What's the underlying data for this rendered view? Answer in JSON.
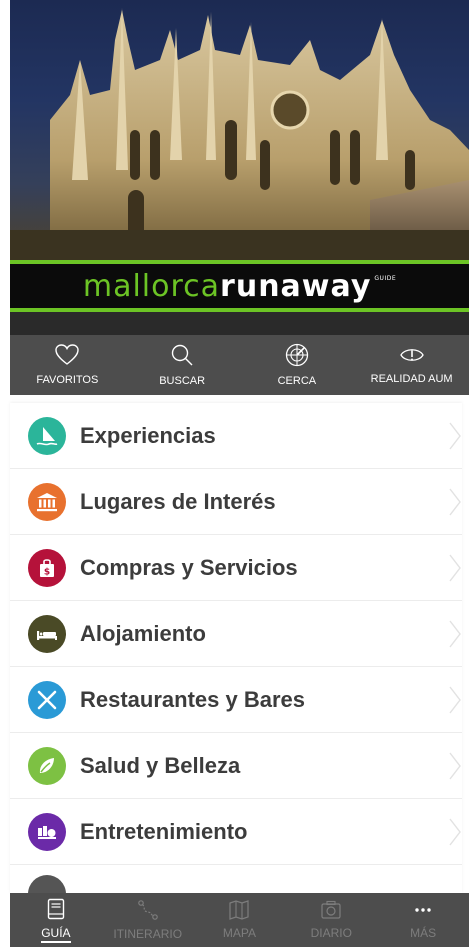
{
  "brand": {
    "part1": "mallorca",
    "part2": "runaway",
    "tag": "GUIDE"
  },
  "quick_actions": [
    {
      "label": "FAVORITOS",
      "icon": "heart-icon"
    },
    {
      "label": "BUSCAR",
      "icon": "search-icon"
    },
    {
      "label": "CERCA",
      "icon": "radar-icon"
    },
    {
      "label": "REALIDAD AUM",
      "icon": "ar-eye-icon"
    }
  ],
  "categories": [
    {
      "label": "Experiencias",
      "icon": "windsurf-icon",
      "color": "#2bb59a"
    },
    {
      "label": "Lugares de Interés",
      "icon": "museum-icon",
      "color": "#e8712e"
    },
    {
      "label": "Compras y Servicios",
      "icon": "shopping-bag-icon",
      "color": "#b5123a"
    },
    {
      "label": "Alojamiento",
      "icon": "bed-icon",
      "color": "#4a4a26"
    },
    {
      "label": "Restaurantes y Bares",
      "icon": "cutlery-icon",
      "color": "#2a9ad6"
    },
    {
      "label": "Salud y Belleza",
      "icon": "leaf-icon",
      "color": "#7dc143"
    },
    {
      "label": "Entretenimiento",
      "icon": "entertainment-icon",
      "color": "#6b2aa8"
    }
  ],
  "tabs": [
    {
      "label": "GUÍA",
      "icon": "book-icon",
      "active": true
    },
    {
      "label": "ITINERARIO",
      "icon": "route-icon",
      "active": false
    },
    {
      "label": "MAPA",
      "icon": "map-icon",
      "active": false
    },
    {
      "label": "DIARIO",
      "icon": "camera-icon",
      "active": false
    },
    {
      "label": "MÁS",
      "icon": "more-icon",
      "active": false
    }
  ],
  "colors": {
    "brand_green": "#6cc425",
    "bar_gray": "#4d4d4d",
    "tab_inactive": "#7d7d7d",
    "text_dark": "#3c3c3c"
  }
}
